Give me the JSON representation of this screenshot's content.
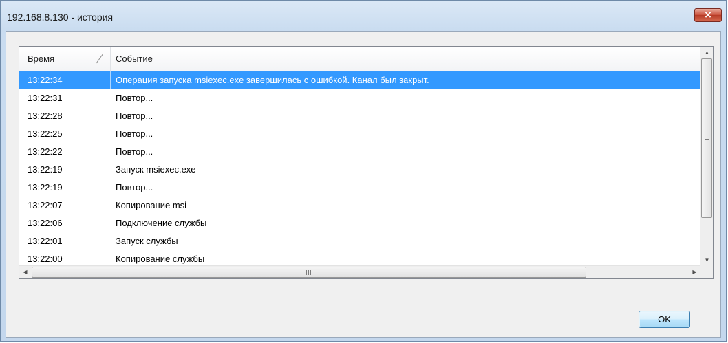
{
  "window": {
    "title": "192.168.8.130 - история",
    "close_symbol": "×"
  },
  "list": {
    "columns": [
      {
        "label": "Время",
        "sorted": "ascending"
      },
      {
        "label": "Событие"
      }
    ],
    "rows": [
      {
        "time": "13:22:34",
        "event": "Операция запуска msiexec.exe завершилась с ошибкой. Канал был закрыт.",
        "selected": true
      },
      {
        "time": "13:22:31",
        "event": "Повтор..."
      },
      {
        "time": "13:22:28",
        "event": "Повтор..."
      },
      {
        "time": "13:22:25",
        "event": "Повтор..."
      },
      {
        "time": "13:22:22",
        "event": "Повтор..."
      },
      {
        "time": "13:22:19",
        "event": "Запуск msiexec.exe"
      },
      {
        "time": "13:22:19",
        "event": "Повтор..."
      },
      {
        "time": "13:22:07",
        "event": "Копирование msi"
      },
      {
        "time": "13:22:06",
        "event": "Подключение службы"
      },
      {
        "time": "13:22:01",
        "event": "Запуск службы"
      },
      {
        "time": "13:22:00",
        "event": "Копирование службы"
      }
    ],
    "icons": {
      "sort": "sort-ascending-icon",
      "scroll_up": "▲",
      "scroll_down": "▼",
      "scroll_left": "◀",
      "scroll_right": "▶"
    }
  },
  "buttons": {
    "ok_label": "OK"
  },
  "colors": {
    "selection": "#3399ff",
    "close_button": "#c9503c"
  }
}
